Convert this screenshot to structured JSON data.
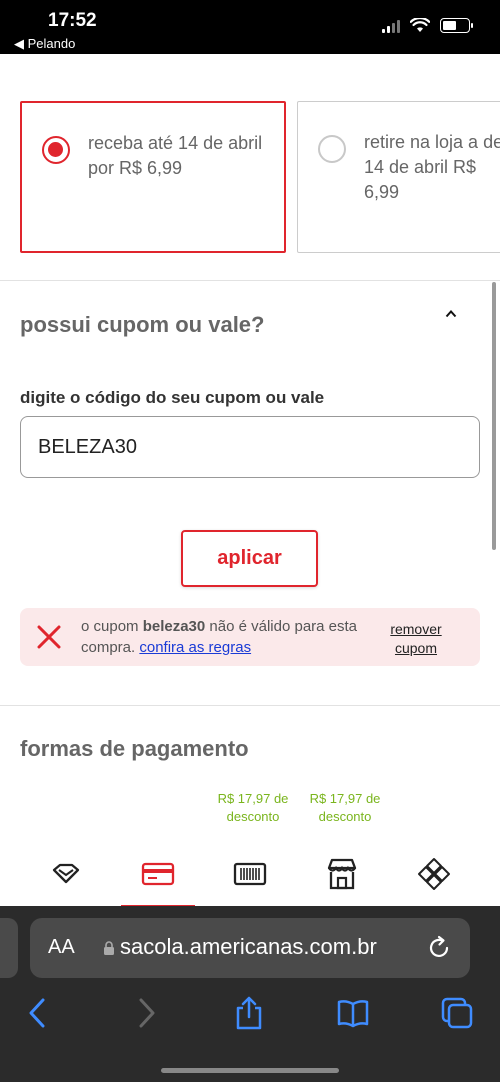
{
  "status_bar": {
    "time": "17:52",
    "back_label": "◀ Pelando"
  },
  "delivery_options": [
    {
      "text": "receba até 14 de abril por R$ 6,99",
      "selected": true
    },
    {
      "text": "retire na loja a de 14 de abril R$ 6,99",
      "selected": false
    }
  ],
  "coupon": {
    "title": "possui cupom ou vale?",
    "field_label": "digite o código do seu cupom ou vale",
    "input_value": "BELEZA30",
    "apply_label": "aplicar",
    "error": {
      "prefix": "o cupom ",
      "code": "beleza30",
      "suffix": " não é válido para esta compra.",
      "link": "confira as regras",
      "remove": "remover cupom"
    }
  },
  "payment": {
    "title": "formas de pagamento",
    "discounts": [
      "R$ 17,97 de desconto",
      "R$ 17,97 de desconto"
    ],
    "methods": [
      "gem-icon",
      "credit-card-icon",
      "barcode-icon",
      "store-icon",
      "pix-icon"
    ]
  },
  "browser": {
    "url": "sacola.americanas.com.br",
    "text_size_label": "AA"
  },
  "colors": {
    "accent": "#e0252d",
    "discount": "#7ab51d",
    "link": "#1a3bd6",
    "error_bg": "#fbe9ea"
  }
}
